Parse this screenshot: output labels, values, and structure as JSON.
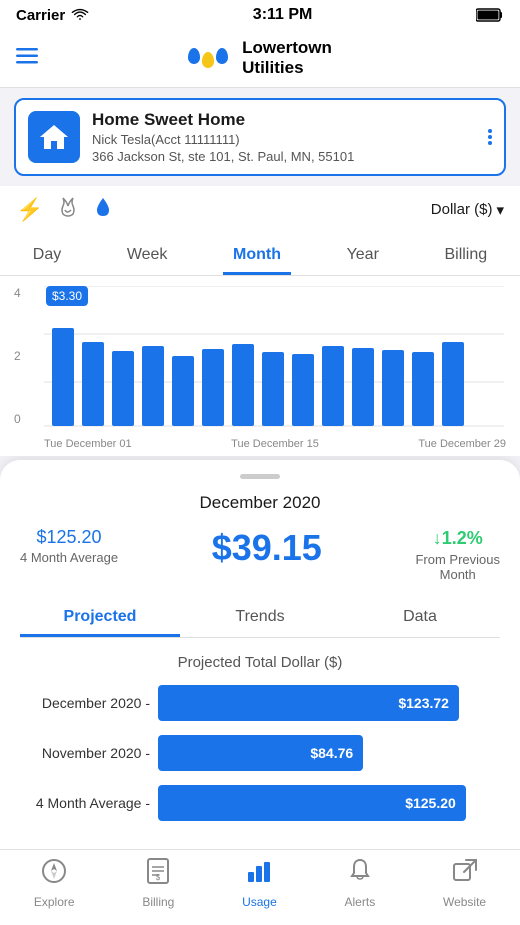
{
  "statusBar": {
    "carrier": "Carrier",
    "time": "3:11 PM",
    "battery": "100%"
  },
  "header": {
    "title1": "Lowertown",
    "title2": "Utilities",
    "menuIcon": "menu-icon"
  },
  "account": {
    "name": "Home Sweet Home",
    "user": "Nick Tesla(Acct 11111111)",
    "address": "366 Jackson St, ste 101, St. Paul, MN, 55101"
  },
  "controls": {
    "dollarsLabel": "Dollar ($)",
    "chevron": "▾"
  },
  "tabs": [
    {
      "label": "Day",
      "active": false
    },
    {
      "label": "Week",
      "active": false
    },
    {
      "label": "Month",
      "active": true
    },
    {
      "label": "Year",
      "active": false
    },
    {
      "label": "Billing",
      "active": false
    }
  ],
  "chart": {
    "tooltip": "$3.30",
    "yLabels": [
      "4",
      "2",
      "0"
    ],
    "xLabels": [
      "Tue December 01",
      "Tue December 15",
      "Tue December 29"
    ],
    "bars": [
      70,
      55,
      45,
      50,
      40,
      48,
      52,
      44,
      42,
      50,
      48,
      46,
      44,
      52
    ]
  },
  "card": {
    "monthTitle": "December 2020",
    "avgAmount": "$125.20",
    "avgLabel": "4 Month Average",
    "currentAmount": "$39.15",
    "changePercent": "↓1.2%",
    "changeLabel": "From Previous Month"
  },
  "subTabs": [
    {
      "label": "Projected",
      "active": true
    },
    {
      "label": "Trends",
      "active": false
    },
    {
      "label": "Data",
      "active": false
    }
  ],
  "projected": {
    "sectionTitle": "Projected Total Dollar ($)",
    "rows": [
      {
        "label": "December 2020 -",
        "value": "$123.72",
        "widthPct": 88
      },
      {
        "label": "November 2020 -",
        "value": "$84.76",
        "widthPct": 60
      },
      {
        "label": "4 Month Average -",
        "value": "$125.20",
        "widthPct": 90
      }
    ]
  },
  "bottomNav": [
    {
      "label": "Explore",
      "icon": "compass",
      "active": false
    },
    {
      "label": "Billing",
      "icon": "billing",
      "active": false
    },
    {
      "label": "Usage",
      "icon": "chart-bar",
      "active": true
    },
    {
      "label": "Alerts",
      "icon": "bell",
      "active": false
    },
    {
      "label": "Website",
      "icon": "external-link",
      "active": false
    }
  ]
}
